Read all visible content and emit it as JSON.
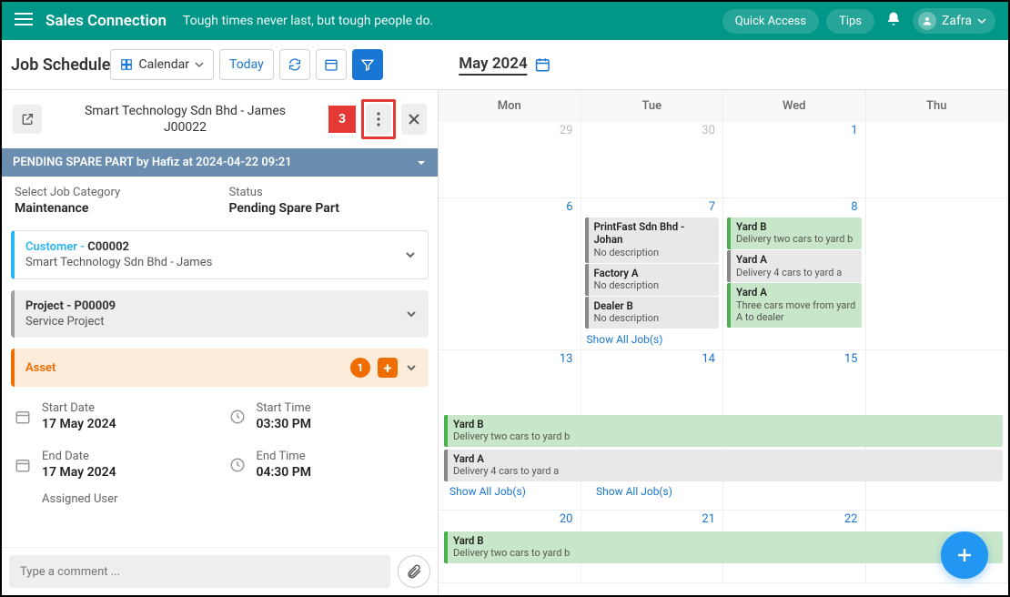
{
  "header": {
    "brand": "Sales Connection",
    "tagline": "Tough times never last, but tough people do.",
    "quick_access": "Quick Access",
    "tips": "Tips",
    "user": "Zafra"
  },
  "page": {
    "title": "Job Schedule",
    "month": "May 2024",
    "calendar_btn": "Calendar",
    "today_btn": "Today"
  },
  "panel": {
    "customer_name": "Smart Technology Sdn Bhd - James",
    "job_no": "J00022",
    "callout_number": "3",
    "status_bar": "PENDING SPARE PART by Hafiz at 2024-04-22 09:21",
    "job_category_label": "Select Job Category",
    "job_category_value": "Maintenance",
    "status_label": "Status",
    "status_value": "Pending Spare Part",
    "customer_card_label": "Customer - ",
    "customer_card_code": "C00002",
    "customer_card_sub": "Smart Technology Sdn Bhd - James",
    "project_card_title": "Project - P00009",
    "project_card_sub": "Service Project",
    "asset_label": "Asset",
    "asset_count": "1",
    "start_date_label": "Start Date",
    "start_date_value": "17 May 2024",
    "start_time_label": "Start Time",
    "start_time_value": "03:30 PM",
    "end_date_label": "End Date",
    "end_date_value": "17 May 2024",
    "end_time_label": "End Time",
    "end_time_value": "04:30 PM",
    "assigned_label": "Assigned User",
    "comment_placeholder": "Type a comment ..."
  },
  "calendar": {
    "days": [
      "Mon",
      "Tue",
      "Wed",
      "Thu"
    ],
    "week1": [
      "29",
      "30",
      "1",
      ""
    ],
    "week2": [
      "6",
      "7",
      "8",
      ""
    ],
    "week3": [
      "13",
      "14",
      "15",
      ""
    ],
    "week4": [
      "20",
      "21",
      "22",
      ""
    ],
    "show_all": "Show All Job(s)",
    "events_w2_tue": [
      {
        "t": "PrintFast Sdn Bhd - Johan",
        "d": "No description",
        "c": "grey"
      },
      {
        "t": "Factory A",
        "d": "No description",
        "c": "grey"
      },
      {
        "t": "Dealer B",
        "d": "No description",
        "c": "grey"
      }
    ],
    "events_w2_wed": [
      {
        "t": "Yard B",
        "d": "Delivery two cars to yard b",
        "c": "green"
      },
      {
        "t": "Yard A",
        "d": "Delivery 4 cars to yard a",
        "c": "grey"
      },
      {
        "t": "Yard A",
        "d": "Three cars move from yard A to dealer",
        "c": "green"
      }
    ],
    "span_w3_1": {
      "t": "Yard B",
      "d": "Delivery two cars to yard b",
      "c": "green"
    },
    "span_w3_2": {
      "t": "Yard A",
      "d": "Delivery 4 cars to yard a",
      "c": "grey"
    },
    "span_w4_1": {
      "t": "Yard B",
      "d": "Delivery two cars to yard b",
      "c": "green"
    }
  }
}
